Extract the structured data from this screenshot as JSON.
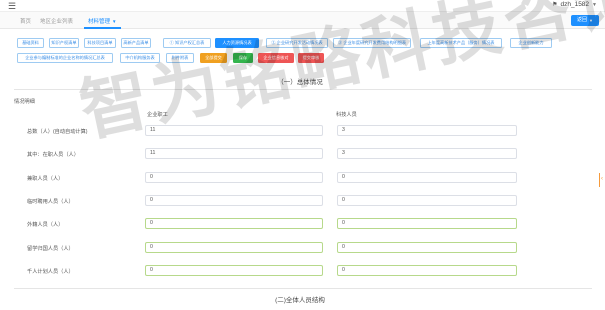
{
  "topbar": {
    "username": "dzh_1582",
    "bell_icon": "bell-icon",
    "menu_icon": "hamburger-menu-icon"
  },
  "tabs": [
    {
      "label": "首页"
    },
    {
      "label": "地区企业列表"
    },
    {
      "label": "材料管理"
    }
  ],
  "return_button": {
    "label": "返回"
  },
  "toolbar": {
    "buttons": [
      {
        "label": "基础资料",
        "style": "outline"
      },
      {
        "label": "知识产权清单",
        "style": "outline"
      },
      {
        "label": "科技项目清单",
        "style": "outline"
      },
      {
        "label": "高新产品清单",
        "style": "outline"
      },
      {
        "label": "① 知识产权汇总表",
        "style": "outline"
      },
      {
        "label": "人力资源情况表",
        "style": "primary"
      },
      {
        "label": "② 企业研究开发活动情况表",
        "style": "outline"
      },
      {
        "label": "③ 企业年度研究开发费用结构明细表",
        "style": "outline"
      },
      {
        "label": "上年度高新技术产品（服务）情况表",
        "style": "outline"
      },
      {
        "label": "企业创新能力",
        "style": "outline"
      },
      {
        "label": "企业参与编制标准的企业名称的情况汇总表",
        "style": "outline"
      },
      {
        "label": "中介机构服务表",
        "style": "outline"
      },
      {
        "label": "附件附表",
        "style": "outline"
      },
      {
        "label": "全部提交",
        "style": "orange"
      },
      {
        "label": "保存",
        "style": "green"
      },
      {
        "label": "企业信息核对",
        "style": "red"
      },
      {
        "label": "提交审核",
        "style": "red"
      }
    ]
  },
  "section1": {
    "title": "（一）总体情况"
  },
  "group_label": "情况明细",
  "columns": {
    "employees": "企业职工",
    "tech_staff": "科技人员"
  },
  "rows": [
    {
      "label": "总数（人）(自动自动计算)",
      "employees": "11",
      "tech": "3"
    },
    {
      "label": "其中：在职人员（人）",
      "employees": "11",
      "tech": "3"
    },
    {
      "label": "兼职人员（人）",
      "employees": "0",
      "tech": "0"
    },
    {
      "label": "临时聘用人员（人）",
      "employees": "0",
      "tech": "0"
    },
    {
      "label": "外籍人员（人）",
      "employees": "0",
      "tech": "0"
    },
    {
      "label": "留学归国人员（人）",
      "employees": "0",
      "tech": "0"
    },
    {
      "label": "千人计划人员（人）",
      "employees": "0",
      "tech": "0"
    }
  ],
  "section2": {
    "title": "(二)全体人员结构"
  },
  "watermark": "智为铭略科技咨询",
  "colors": {
    "accent": "#1e90ff",
    "orange": "#f0a020",
    "green": "#34b54e",
    "red": "#ee5555",
    "valid_border": "#b7d98b"
  }
}
